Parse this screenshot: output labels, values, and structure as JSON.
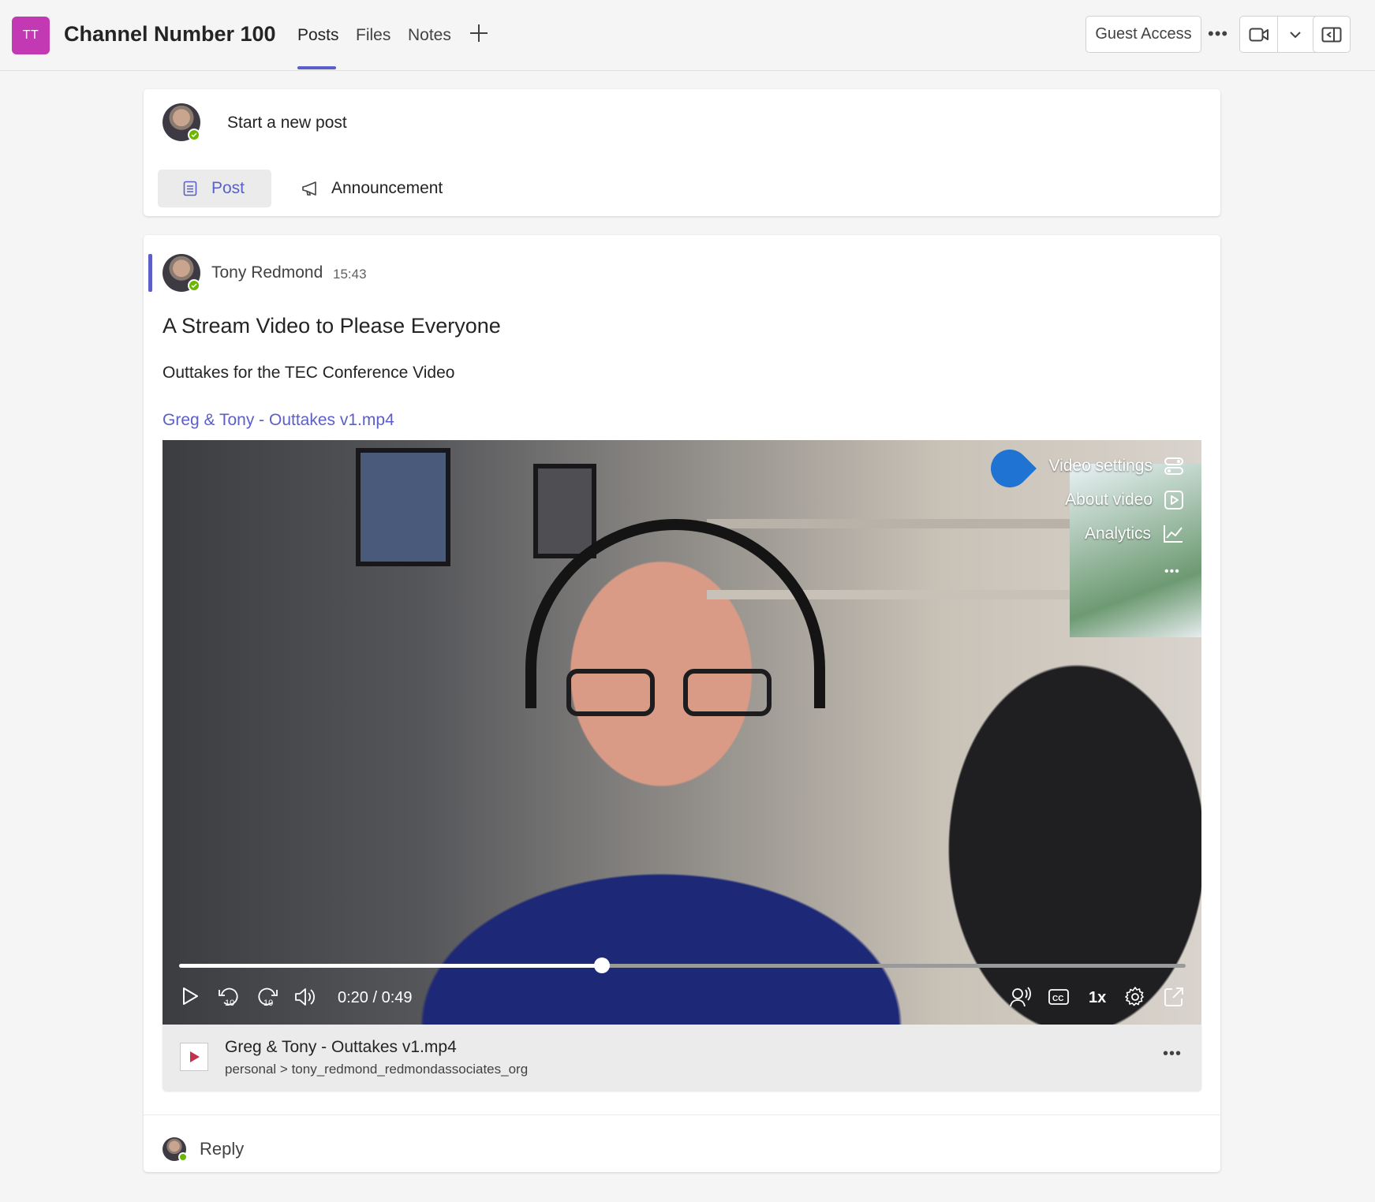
{
  "header": {
    "team_initials": "TT",
    "channel_name": "Channel Number 100",
    "tabs": [
      {
        "label": "Posts",
        "active": true
      },
      {
        "label": "Files",
        "active": false
      },
      {
        "label": "Notes",
        "active": false
      }
    ],
    "guest_access_label": "Guest Access"
  },
  "composer": {
    "placeholder": "Start a new post",
    "post_label": "Post",
    "announcement_label": "Announcement"
  },
  "post": {
    "author": "Tony Redmond",
    "time": "15:43",
    "title": "A Stream Video to Please Everyone",
    "body": "Outtakes for the TEC Conference Video",
    "link_text": "Greg & Tony - Outtakes v1.mp4",
    "video": {
      "overlay_menu": [
        "Video settings",
        "About video",
        "Analytics"
      ],
      "time_display": "0:20 / 0:49",
      "progress": 0.42,
      "speed": "1x"
    },
    "file": {
      "name": "Greg & Tony - Outtakes v1.mp4",
      "path": "personal > tony_redmond_redmondassociates_org"
    },
    "reply_label": "Reply"
  },
  "colors": {
    "accent": "#5b5fc7",
    "team_avatar": "#c239b3",
    "presence": "#6bb700",
    "video_settings_dot": "#1f73d2"
  }
}
